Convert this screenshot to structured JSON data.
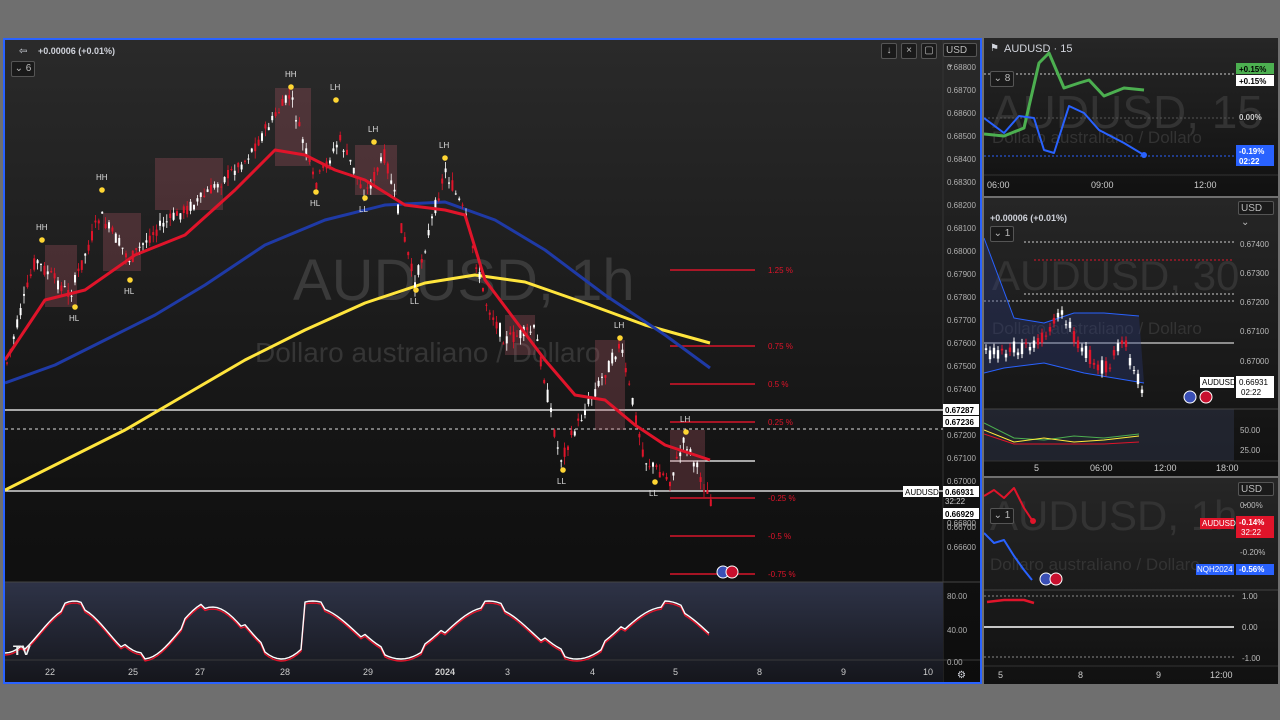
{
  "main": {
    "change": "+0.00006 (+0.01%)",
    "indicator_count": "6",
    "currency": "USD",
    "watermark_symbol": "AUDUSD, 1h",
    "watermark_desc": "Dollaro australiano / Dollaro",
    "y_ticks": [
      "0.68800",
      "0.68700",
      "0.68600",
      "0.68500",
      "0.68400",
      "0.68300",
      "0.68200",
      "0.68100",
      "0.68000",
      "0.67900",
      "0.67800",
      "0.67700",
      "0.67600",
      "0.67500",
      "0.67400",
      "0.67300",
      "0.67200",
      "0.67100",
      "0.67000",
      "0.66800",
      "0.66700",
      "0.66600"
    ],
    "price_levels": [
      "0.67287",
      "0.67236",
      "0.66931",
      "0.66929"
    ],
    "symbol_tag": "AUDUSD",
    "countdown": "32:22",
    "x_ticks": [
      "22",
      "25",
      "27",
      "28",
      "29",
      "2024",
      "3",
      "4",
      "5",
      "8",
      "9",
      "10"
    ],
    "osc_ticks": [
      "80.00",
      "40.00",
      "0.00"
    ],
    "fib_labels": [
      "1.25 %",
      "0.75 %",
      "0.5 %",
      "0.25 %",
      "-0.25 %",
      "-0.5 %",
      "-0.75 %"
    ],
    "swing_labels": [
      "HH",
      "HH",
      "HH",
      "LH",
      "LH",
      "LH",
      "LH",
      "LH",
      "HL",
      "HL",
      "HL",
      "LL",
      "LL",
      "LL",
      "LL"
    ],
    "logo": "TV"
  },
  "p1": {
    "symbol": "AUDUSD · 15",
    "count": "8",
    "tags": [
      "+0.15%",
      "+0.15%",
      "0.00%",
      "-0.19%",
      "02:22"
    ],
    "x_ticks": [
      "06:00",
      "09:00",
      "12:00"
    ]
  },
  "p2": {
    "change": "+0.00006 (+0.01%)",
    "count": "1",
    "currency": "USD",
    "watermark": "AUDUSD, 30",
    "watermark_desc": "Dollaro australiano / Dollaro",
    "y_ticks": [
      "0.67400",
      "0.67300",
      "0.67200",
      "0.67100",
      "0.67000",
      "0.66900"
    ],
    "symbol_tag": "AUDUSD",
    "price": "0.66931",
    "countdown": "02:22",
    "osc_ticks": [
      "50.00",
      "25.00"
    ],
    "x_ticks": [
      "5",
      "06:00",
      "12:00",
      "18:00"
    ]
  },
  "p3": {
    "count": "1",
    "currency": "USD",
    "watermark": "AUDUSD, 1h",
    "watermark_desc": "Dollaro australiano / Dollaro",
    "y_ticks": [
      "0.00%",
      "-0.20%",
      "-0.40%"
    ],
    "tag1": "AUDUSD",
    "tag1_val": "-0.14%",
    "tag1_time": "32:22",
    "tag2": "NQH2024",
    "tag2_val": "-0.56%",
    "osc_ticks": [
      "1.00",
      "0.00",
      "-1.00"
    ],
    "x_ticks": [
      "5",
      "8",
      "9",
      "12:00"
    ]
  },
  "colors": {
    "accent": "#2962ff",
    "red": "#e0142a",
    "yellow": "#ffeb3b",
    "navy": "#1a3a9c",
    "green": "#4caf50"
  }
}
